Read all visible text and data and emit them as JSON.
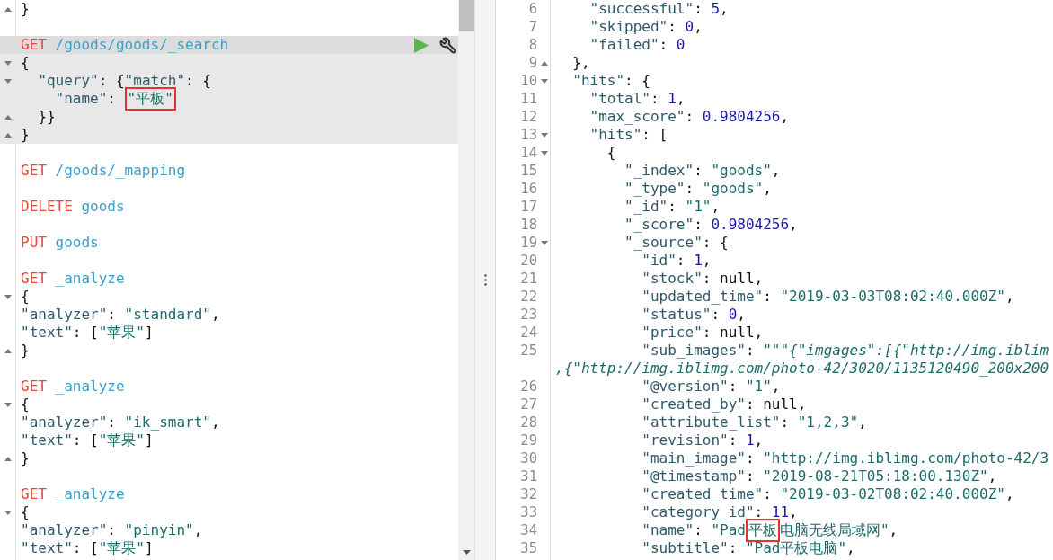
{
  "editor": {
    "blocks": [
      {
        "selected": false,
        "lines": [
          {
            "kind": "closer",
            "tokens": [
              {
                "kind": "punct",
                "text": "}"
              }
            ]
          }
        ]
      },
      {
        "selected": true,
        "lines": [
          {
            "kind": "plain",
            "tokens": [
              {
                "kind": "method",
                "text": "GET"
              },
              {
                "kind": "path",
                "text": "/goods/goods/_search"
              }
            ]
          },
          {
            "kind": "opener",
            "tokens": [
              {
                "kind": "punct",
                "text": "{"
              }
            ]
          },
          {
            "kind": "opener",
            "tokens": [
              {
                "kind": "key",
                "text": "  \"query\""
              },
              {
                "kind": "punct",
                "text": ": {"
              },
              {
                "kind": "key",
                "text": "\"match\""
              },
              {
                "kind": "punct",
                "text": ": {"
              }
            ]
          },
          {
            "kind": "plain",
            "tokens": [
              {
                "kind": "key",
                "text": "    \"name\""
              },
              {
                "kind": "punct",
                "text": ": "
              },
              {
                "kind": "marked",
                "text": "\"平板\""
              }
            ]
          },
          {
            "kind": "closer",
            "tokens": [
              {
                "kind": "punct",
                "text": "  }}"
              }
            ]
          },
          {
            "kind": "closer",
            "tokens": [
              {
                "kind": "punct",
                "text": "}"
              }
            ]
          }
        ]
      },
      {
        "selected": false,
        "lines": [
          {
            "kind": "plain",
            "tokens": [
              {
                "kind": "method",
                "text": "GET"
              },
              {
                "kind": "path",
                "text": "/goods/_mapping"
              }
            ]
          }
        ]
      },
      {
        "selected": false,
        "lines": [
          {
            "kind": "plain",
            "tokens": [
              {
                "kind": "method",
                "text": "DELETE"
              },
              {
                "kind": "path",
                "text": "goods"
              }
            ]
          }
        ]
      },
      {
        "selected": false,
        "lines": [
          {
            "kind": "plain",
            "tokens": [
              {
                "kind": "method",
                "text": "PUT"
              },
              {
                "kind": "path",
                "text": "goods"
              }
            ]
          }
        ]
      },
      {
        "selected": false,
        "lines": [
          {
            "kind": "plain",
            "tokens": [
              {
                "kind": "method",
                "text": "GET"
              },
              {
                "kind": "path",
                "text": "_analyze"
              }
            ]
          },
          {
            "kind": "opener",
            "tokens": [
              {
                "kind": "punct",
                "text": "{"
              }
            ]
          },
          {
            "kind": "plain",
            "tokens": [
              {
                "kind": "key",
                "text": "\"analyzer\""
              },
              {
                "kind": "punct",
                "text": ": "
              },
              {
                "kind": "string",
                "text": "\"standard\""
              },
              {
                "kind": "punct",
                "text": ","
              }
            ]
          },
          {
            "kind": "plain",
            "tokens": [
              {
                "kind": "key",
                "text": "\"text\""
              },
              {
                "kind": "punct",
                "text": ": ["
              },
              {
                "kind": "string",
                "text": "\"苹果\""
              },
              {
                "kind": "punct",
                "text": "]"
              }
            ]
          },
          {
            "kind": "closer",
            "tokens": [
              {
                "kind": "punct",
                "text": "}"
              }
            ]
          }
        ]
      },
      {
        "selected": false,
        "lines": [
          {
            "kind": "plain",
            "tokens": [
              {
                "kind": "method",
                "text": "GET"
              },
              {
                "kind": "path",
                "text": "_analyze"
              }
            ]
          },
          {
            "kind": "opener",
            "tokens": [
              {
                "kind": "punct",
                "text": "{"
              }
            ]
          },
          {
            "kind": "plain",
            "tokens": [
              {
                "kind": "key",
                "text": "\"analyzer\""
              },
              {
                "kind": "punct",
                "text": ": "
              },
              {
                "kind": "string",
                "text": "\"ik_smart\""
              },
              {
                "kind": "punct",
                "text": ","
              }
            ]
          },
          {
            "kind": "plain",
            "tokens": [
              {
                "kind": "key",
                "text": "\"text\""
              },
              {
                "kind": "punct",
                "text": ": ["
              },
              {
                "kind": "string",
                "text": "\"苹果\""
              },
              {
                "kind": "punct",
                "text": "]"
              }
            ]
          },
          {
            "kind": "closer",
            "tokens": [
              {
                "kind": "punct",
                "text": "}"
              }
            ]
          }
        ]
      },
      {
        "selected": false,
        "lines": [
          {
            "kind": "plain",
            "tokens": [
              {
                "kind": "method",
                "text": "GET"
              },
              {
                "kind": "path",
                "text": "_analyze"
              }
            ]
          },
          {
            "kind": "opener",
            "tokens": [
              {
                "kind": "punct",
                "text": "{"
              }
            ]
          },
          {
            "kind": "plain",
            "tokens": [
              {
                "kind": "key",
                "text": "\"analyzer\""
              },
              {
                "kind": "punct",
                "text": ": "
              },
              {
                "kind": "string",
                "text": "\"pinyin\""
              },
              {
                "kind": "punct",
                "text": ","
              }
            ]
          },
          {
            "kind": "plain",
            "tokens": [
              {
                "kind": "key",
                "text": "\"text\""
              },
              {
                "kind": "punct",
                "text": ": ["
              },
              {
                "kind": "string",
                "text": "\"苹果\""
              },
              {
                "kind": "punct",
                "text": "]"
              }
            ]
          }
        ]
      }
    ]
  },
  "response": {
    "lines": [
      {
        "number": "6",
        "kind": "plain",
        "tokens": [
          {
            "kind": "key",
            "text": "    \"successful\""
          },
          {
            "kind": "punct",
            "text": ": "
          },
          {
            "kind": "number",
            "text": "5"
          },
          {
            "kind": "punct",
            "text": ","
          }
        ]
      },
      {
        "number": "7",
        "kind": "plain",
        "tokens": [
          {
            "kind": "key",
            "text": "    \"skipped\""
          },
          {
            "kind": "punct",
            "text": ": "
          },
          {
            "kind": "number",
            "text": "0"
          },
          {
            "kind": "punct",
            "text": ","
          }
        ]
      },
      {
        "number": "8",
        "kind": "plain",
        "tokens": [
          {
            "kind": "key",
            "text": "    \"failed\""
          },
          {
            "kind": "punct",
            "text": ": "
          },
          {
            "kind": "number",
            "text": "0"
          }
        ]
      },
      {
        "number": "9",
        "kind": "closer",
        "tokens": [
          {
            "kind": "punct",
            "text": "  },"
          }
        ]
      },
      {
        "number": "10",
        "kind": "opener",
        "tokens": [
          {
            "kind": "key",
            "text": "  \"hits\""
          },
          {
            "kind": "punct",
            "text": ": {"
          }
        ]
      },
      {
        "number": "11",
        "kind": "plain",
        "tokens": [
          {
            "kind": "key",
            "text": "    \"total\""
          },
          {
            "kind": "punct",
            "text": ": "
          },
          {
            "kind": "number",
            "text": "1"
          },
          {
            "kind": "punct",
            "text": ","
          }
        ]
      },
      {
        "number": "12",
        "kind": "plain",
        "tokens": [
          {
            "kind": "key",
            "text": "    \"max_score\""
          },
          {
            "kind": "punct",
            "text": ": "
          },
          {
            "kind": "number",
            "text": "0.9804256"
          },
          {
            "kind": "punct",
            "text": ","
          }
        ]
      },
      {
        "number": "13",
        "kind": "opener",
        "tokens": [
          {
            "kind": "key",
            "text": "    \"hits\""
          },
          {
            "kind": "punct",
            "text": ": ["
          }
        ]
      },
      {
        "number": "14",
        "kind": "opener",
        "tokens": [
          {
            "kind": "punct",
            "text": "      {"
          }
        ]
      },
      {
        "number": "15",
        "kind": "plain",
        "tokens": [
          {
            "kind": "key",
            "text": "        \"_index\""
          },
          {
            "kind": "punct",
            "text": ": "
          },
          {
            "kind": "string",
            "text": "\"goods\""
          },
          {
            "kind": "punct",
            "text": ","
          }
        ]
      },
      {
        "number": "16",
        "kind": "plain",
        "tokens": [
          {
            "kind": "key",
            "text": "        \"_type\""
          },
          {
            "kind": "punct",
            "text": ": "
          },
          {
            "kind": "string",
            "text": "\"goods\""
          },
          {
            "kind": "punct",
            "text": ","
          }
        ]
      },
      {
        "number": "17",
        "kind": "plain",
        "tokens": [
          {
            "kind": "key",
            "text": "        \"_id\""
          },
          {
            "kind": "punct",
            "text": ": "
          },
          {
            "kind": "string",
            "text": "\"1\""
          },
          {
            "kind": "punct",
            "text": ","
          }
        ]
      },
      {
        "number": "18",
        "kind": "plain",
        "tokens": [
          {
            "kind": "key",
            "text": "        \"_score\""
          },
          {
            "kind": "punct",
            "text": ": "
          },
          {
            "kind": "number",
            "text": "0.9804256"
          },
          {
            "kind": "punct",
            "text": ","
          }
        ]
      },
      {
        "number": "19",
        "kind": "opener",
        "tokens": [
          {
            "kind": "key",
            "text": "        \"_source\""
          },
          {
            "kind": "punct",
            "text": ": {"
          }
        ]
      },
      {
        "number": "20",
        "kind": "plain",
        "tokens": [
          {
            "kind": "key",
            "text": "          \"id\""
          },
          {
            "kind": "punct",
            "text": ": "
          },
          {
            "kind": "number",
            "text": "1"
          },
          {
            "kind": "punct",
            "text": ","
          }
        ]
      },
      {
        "number": "21",
        "kind": "plain",
        "tokens": [
          {
            "kind": "key",
            "text": "          \"stock\""
          },
          {
            "kind": "punct",
            "text": ": null,"
          }
        ]
      },
      {
        "number": "22",
        "kind": "plain",
        "tokens": [
          {
            "kind": "key",
            "text": "          \"updated_time\""
          },
          {
            "kind": "punct",
            "text": ": "
          },
          {
            "kind": "string",
            "text": "\"2019-03-03T08:02:40.000Z\""
          },
          {
            "kind": "punct",
            "text": ","
          }
        ]
      },
      {
        "number": "23",
        "kind": "plain",
        "tokens": [
          {
            "kind": "key",
            "text": "          \"status\""
          },
          {
            "kind": "punct",
            "text": ": "
          },
          {
            "kind": "number",
            "text": "0"
          },
          {
            "kind": "punct",
            "text": ","
          }
        ]
      },
      {
        "number": "24",
        "kind": "plain",
        "tokens": [
          {
            "kind": "key",
            "text": "          \"price\""
          },
          {
            "kind": "punct",
            "text": ": null,"
          }
        ]
      },
      {
        "number": "25",
        "kind": "plain",
        "tokens": [
          {
            "kind": "key",
            "text": "          \"sub_images\""
          },
          {
            "kind": "punct",
            "text": ": "
          },
          {
            "kind": "string",
            "text": "\"\"\""
          },
          {
            "kind": "istring",
            "text": "{\"imgages\":[{\"http://img.iblim"
          }
        ]
      },
      {
        "kind": "plain",
        "tokens": [
          {
            "kind": "istring",
            "text": ",{\"http://img.iblimg.com/photo-42/3020/1135120490_200x200"
          }
        ]
      },
      {
        "number": "26",
        "kind": "plain",
        "tokens": [
          {
            "kind": "key",
            "text": "          \"@version\""
          },
          {
            "kind": "punct",
            "text": ": "
          },
          {
            "kind": "string",
            "text": "\"1\""
          },
          {
            "kind": "punct",
            "text": ","
          }
        ]
      },
      {
        "number": "27",
        "kind": "plain",
        "tokens": [
          {
            "kind": "key",
            "text": "          \"created_by\""
          },
          {
            "kind": "punct",
            "text": ": null,"
          }
        ]
      },
      {
        "number": "28",
        "kind": "plain",
        "tokens": [
          {
            "kind": "key",
            "text": "          \"attribute_list\""
          },
          {
            "kind": "punct",
            "text": ": "
          },
          {
            "kind": "string",
            "text": "\"1,2,3\""
          },
          {
            "kind": "punct",
            "text": ","
          }
        ]
      },
      {
        "number": "29",
        "kind": "plain",
        "tokens": [
          {
            "kind": "key",
            "text": "          \"revision\""
          },
          {
            "kind": "punct",
            "text": ": "
          },
          {
            "kind": "number",
            "text": "1"
          },
          {
            "kind": "punct",
            "text": ","
          }
        ]
      },
      {
        "number": "30",
        "kind": "plain",
        "tokens": [
          {
            "kind": "key",
            "text": "          \"main_image\""
          },
          {
            "kind": "punct",
            "text": ": "
          },
          {
            "kind": "string",
            "text": "\"http://img.iblimg.com/photo-42/3"
          }
        ]
      },
      {
        "number": "31",
        "kind": "plain",
        "tokens": [
          {
            "kind": "key",
            "text": "          \"@timestamp\""
          },
          {
            "kind": "punct",
            "text": ": "
          },
          {
            "kind": "string",
            "text": "\"2019-08-21T05:18:00.130Z\""
          },
          {
            "kind": "punct",
            "text": ","
          }
        ]
      },
      {
        "number": "32",
        "kind": "plain",
        "tokens": [
          {
            "kind": "key",
            "text": "          \"created_time\""
          },
          {
            "kind": "punct",
            "text": ": "
          },
          {
            "kind": "string",
            "text": "\"2019-03-02T08:02:40.000Z\""
          },
          {
            "kind": "punct",
            "text": ","
          }
        ]
      },
      {
        "number": "33",
        "kind": "plain",
        "tokens": [
          {
            "kind": "key",
            "text": "          \"category_id\""
          },
          {
            "kind": "punct",
            "text": ": "
          },
          {
            "kind": "number",
            "text": "11"
          },
          {
            "kind": "punct",
            "text": ","
          }
        ]
      },
      {
        "number": "34",
        "kind": "plain",
        "tokens": [
          {
            "kind": "key",
            "text": "          \"name\""
          },
          {
            "kind": "punct",
            "text": ": "
          },
          {
            "kind": "string",
            "text": "\"Pad"
          },
          {
            "kind": "marked",
            "text": "平板"
          },
          {
            "kind": "string",
            "text": "电脑无线局域网\""
          },
          {
            "kind": "punct",
            "text": ","
          }
        ]
      },
      {
        "number": "35",
        "kind": "plain",
        "tokens": [
          {
            "kind": "key",
            "text": "          \"subtitle\""
          },
          {
            "kind": "punct",
            "text": ": "
          },
          {
            "kind": "string",
            "text": "\"Pad平板电脑\""
          },
          {
            "kind": "punct",
            "text": ","
          }
        ]
      }
    ]
  }
}
